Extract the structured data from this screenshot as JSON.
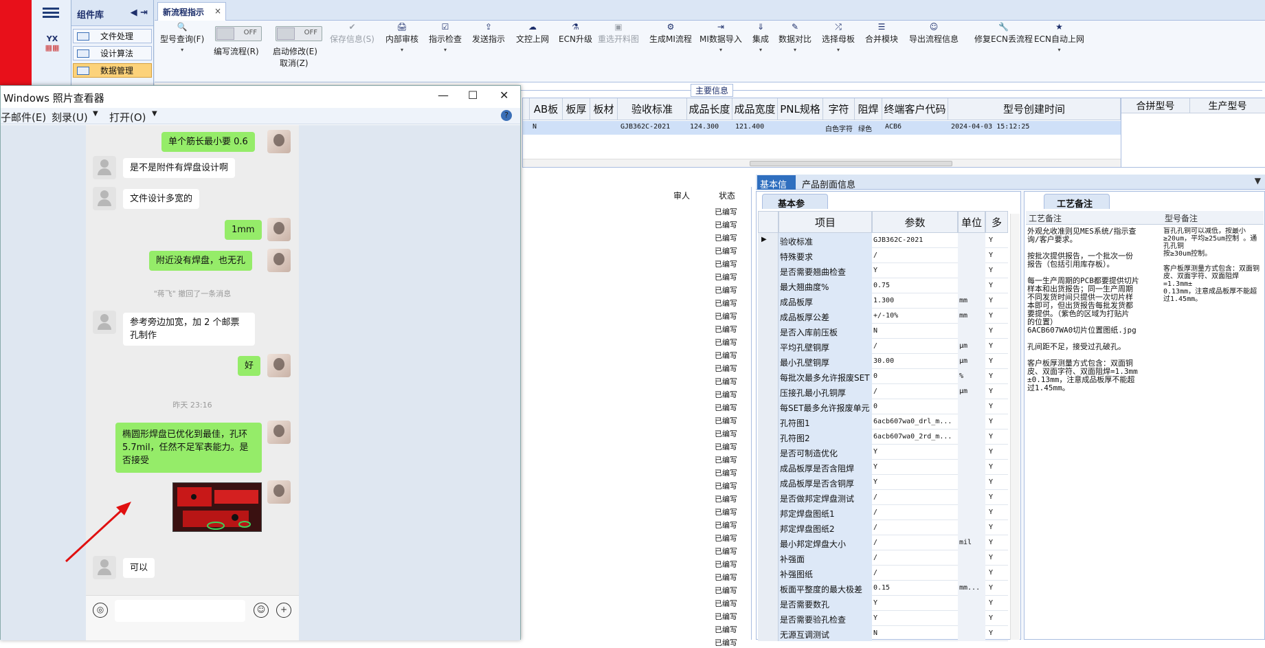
{
  "component_lib": {
    "title": "组件库",
    "items": [
      "文件处理",
      "设计算法",
      "数据管理"
    ],
    "yx": "YX"
  },
  "tab": {
    "label": "新流程指示",
    "close": "×"
  },
  "ribbon": {
    "buttons": [
      {
        "label": "型号查询(F)",
        "icon": "🔍"
      },
      {
        "label": "保存信息(S)",
        "icon": "✔"
      },
      {
        "label": "内部审核",
        "icon": "🖨"
      },
      {
        "label": "指示检查",
        "icon": "☑"
      },
      {
        "label": "发送指示",
        "icon": "⇪"
      },
      {
        "label": "文控上网",
        "icon": "☁"
      },
      {
        "label": "ECN升级",
        "icon": "⚗"
      },
      {
        "label": "重选开料图",
        "icon": "▣"
      },
      {
        "label": "生成MI流程",
        "icon": "⚙"
      },
      {
        "label": "MI数据导入",
        "icon": "⇥"
      },
      {
        "label": "集成",
        "icon": "⇓"
      },
      {
        "label": "数据对比",
        "icon": "✎"
      },
      {
        "label": "选择母板",
        "icon": "⤮"
      },
      {
        "label": "合并模块",
        "icon": "☰"
      },
      {
        "label": "导出流程信息",
        "icon": "☺"
      },
      {
        "label": "修复ECN丢流程",
        "icon": "🔧"
      },
      {
        "label": "ECN自动上网",
        "icon": "★"
      }
    ],
    "toggle1": {
      "state": "OFF",
      "label": "编写流程(R)"
    },
    "toggle2": {
      "state": "OFF",
      "label": "启动修改(E)",
      "sub": "取消(Z)"
    }
  },
  "main_info_label": "主要信息",
  "top_table": {
    "headers": [
      "AB板",
      "板厚",
      "板材",
      "验收标准",
      "成品长度",
      "成品宽度",
      "PNL规格",
      "字符",
      "阻焊",
      "终端客户代码",
      "型号创建时间"
    ],
    "row": {
      "ab": "N",
      "std": "GJB362C-2021",
      "len": "124.300",
      "wid": "121.400",
      "char": "白色字符",
      "mask": "绿色",
      "cust": "ACB6",
      "time": "2024-04-03 15:12:25"
    },
    "right_headers": [
      "合拼型号",
      "生产型号"
    ]
  },
  "status_col": {
    "headers": [
      "审人",
      "状态"
    ],
    "value": "已编写"
  },
  "info_tabs": [
    "基本信息",
    "产品剖面信息"
  ],
  "params": {
    "tab": "基本参数",
    "headers": [
      "项目",
      "参数",
      "单位",
      "多"
    ],
    "rows": [
      [
        "验收标准",
        "GJB362C-2021",
        "",
        "Y"
      ],
      [
        "特殊要求",
        "/",
        "",
        "Y"
      ],
      [
        "是否需要翘曲检查",
        "Y",
        "",
        "Y"
      ],
      [
        "最大翘曲度%",
        "0.75",
        "",
        "Y"
      ],
      [
        "成品板厚",
        "1.300",
        "mm",
        "Y"
      ],
      [
        "成品板厚公差",
        "+/-10%",
        "mm",
        "Y"
      ],
      [
        "是否入库前压板",
        "N",
        "",
        "Y"
      ],
      [
        "平均孔壁铜厚",
        "/",
        "μm",
        "Y"
      ],
      [
        "最小孔壁铜厚",
        "30.00",
        "μm",
        "Y"
      ],
      [
        "每批次最多允许报废SET",
        "0",
        "%",
        "Y"
      ],
      [
        "压接孔最小孔铜厚",
        "/",
        "μm",
        "Y"
      ],
      [
        "每SET最多允许报废单元",
        "0",
        "",
        "Y"
      ],
      [
        "孔符图1",
        "6acb607wa0_drl_m...",
        "",
        "Y"
      ],
      [
        "孔符图2",
        "6acb607wa0_2rd_m...",
        "",
        "Y"
      ],
      [
        "是否可制造优化",
        "Y",
        "",
        "Y"
      ],
      [
        "成品板厚是否含阻焊",
        "Y",
        "",
        "Y"
      ],
      [
        "成品板厚是否含铜厚",
        "Y",
        "",
        "Y"
      ],
      [
        "是否做邦定焊盘测试",
        "/",
        "",
        "Y"
      ],
      [
        "邦定焊盘图纸1",
        "/",
        "",
        "Y"
      ],
      [
        "邦定焊盘图纸2",
        "/",
        "",
        "Y"
      ],
      [
        "最小邦定焊盘大小",
        "/",
        "mil",
        "Y"
      ],
      [
        "补强面",
        "/",
        "",
        "Y"
      ],
      [
        "补强图纸",
        "/",
        "",
        "Y"
      ],
      [
        "板面平整度的最大极差",
        "0.15",
        "mm...",
        "Y"
      ],
      [
        "是否需要数孔",
        "Y",
        "",
        "Y"
      ],
      [
        "是否需要验孔检查",
        "Y",
        "",
        "Y"
      ],
      [
        "无源互调测试",
        "N",
        "",
        "Y"
      ]
    ]
  },
  "remark": {
    "tab": "工艺备注",
    "col1": "工艺备注",
    "col2": "型号备注",
    "text1": "外观允收准则见MES系统/指示查\n询/客户要求。\n\n按批次提供报告，一个批次一份\n报告（包括引用库存板）。\n\n每一生产周期的PCB都要提供切片\n样本和出货报告；同一生产周期\n不同发货时间只提供一次切片样\n本即可，但出货报告每批发货都\n要提供。（紫色的区域为打贴片\n的位置）\n6ACB607WA0切片位置图纸.jpg\n\n孔间距不足，接受过孔破孔。\n\n客户板厚测量方式包含：双面铜\n皮、双面字符、双面阻焊=1.3mm\n±0.13mm，注意成品板厚不能超\n过1.45mm。",
    "text2": "盲孔孔铜可以减低，按最小≥20um，平均≥25um控制 。通孔孔铜\n按≥30um控制。\n\n客户板厚测量方式包含：双面铜皮、双面字符、双面阻焊=1.3mm±\n0.13mm，注意成品板厚不能超过1.45mm。"
  },
  "viewer": {
    "title": "Windows 照片查看器",
    "menu": [
      "子邮件(E)",
      "刻录(U)",
      "打开(O)"
    ],
    "help": "?",
    "min": "—",
    "max": "☐",
    "close": "✕"
  },
  "chat": {
    "messages": [
      {
        "who": "me",
        "text": "单个筋长最小要 0.6"
      },
      {
        "who": "them",
        "text": "是不是附件有焊盘设计啊"
      },
      {
        "who": "them",
        "text": "文件设计多宽的"
      },
      {
        "who": "me",
        "text": "1mm"
      },
      {
        "who": "me",
        "text": "附近没有焊盘，也无孔"
      },
      {
        "who": "sys",
        "text": "\"蒋飞\" 撤回了一条消息"
      },
      {
        "who": "them",
        "text": "参考旁边加宽，加 2 个邮票孔制作"
      },
      {
        "who": "me",
        "text": "好"
      },
      {
        "who": "sys",
        "text": "昨天 23:16"
      },
      {
        "who": "me",
        "text": "椭圆形焊盘已优化到最佳，孔环 5.7mil，任然不足军表能力。是否接受"
      },
      {
        "who": "them",
        "text": "可以"
      }
    ]
  }
}
